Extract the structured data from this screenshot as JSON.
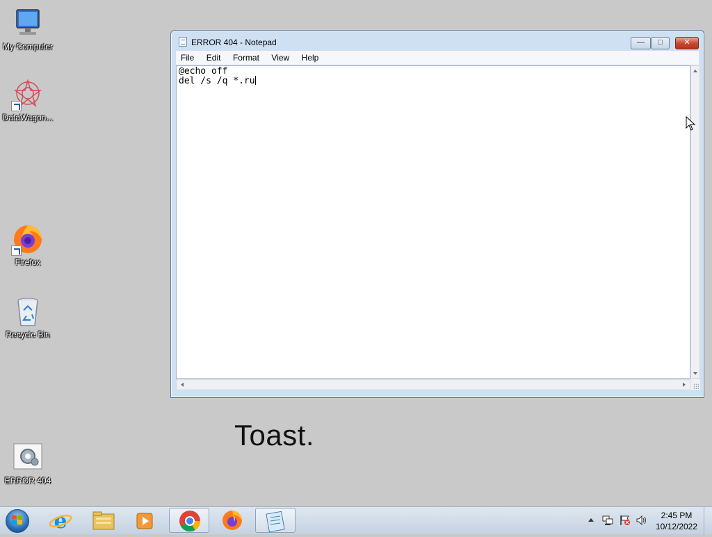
{
  "desktop": {
    "icons": [
      {
        "label": "My Computer",
        "icon": "computer-icon"
      },
      {
        "label": "DataWagon...",
        "icon": "datawagon-icon"
      },
      {
        "label": "Firefox",
        "icon": "firefox-icon"
      },
      {
        "label": "Recycle Bin",
        "icon": "recycle-bin-icon"
      },
      {
        "label": "ERROR 404",
        "icon": "batch-file-icon"
      }
    ],
    "toast_text": "Toast."
  },
  "notepad": {
    "title": "ERROR 404 - Notepad",
    "menu": [
      "File",
      "Edit",
      "Format",
      "View",
      "Help"
    ],
    "lines": [
      "@echo off",
      "del /s /q *.ru"
    ],
    "controls": {
      "minimize": "minimize-icon",
      "maximize": "maximize-icon",
      "close": "close-icon"
    }
  },
  "taskbar": {
    "pinned": [
      "internet-explorer-icon",
      "file-explorer-icon",
      "media-player-icon",
      "chrome-icon",
      "firefox-icon",
      "notepad-icon"
    ],
    "active_apps": [
      "chrome-icon",
      "notepad-icon"
    ],
    "tray_icons": [
      "show-hidden-icons-arrow",
      "network-icon",
      "action-center-icon",
      "volume-icon"
    ],
    "clock": {
      "time": "2:45 PM",
      "date": "10/12/2022"
    }
  },
  "colors": {
    "desktop_bg": "#c9c9c9",
    "window_frame": "#cfe0f3",
    "close_button": "#c6462e"
  }
}
